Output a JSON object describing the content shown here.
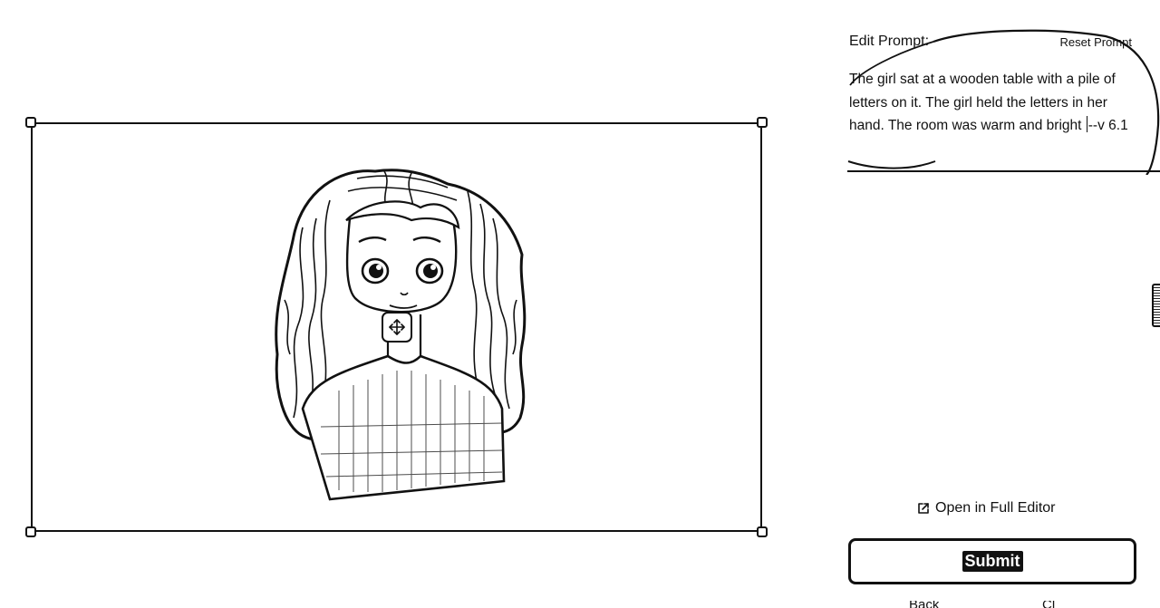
{
  "editor": {
    "title": "Edit Prompt:",
    "reset_label": "Reset Prompt",
    "prompt_before_cursor": "The girl sat at a wooden table with a pile of letters on it. The girl held the letters in her hand. The room was warm and bright ",
    "prompt_after_cursor": "--v 6.1",
    "open_full_editor_label": "Open in Full Editor",
    "submit_label": "Submit"
  },
  "footer": {
    "left_label": "Back",
    "right_label": "Cl"
  },
  "icons": {
    "move": "move-arrows-icon",
    "external_link": "external-link-icon"
  },
  "colors": {
    "ink": "#111111",
    "background": "#ffffff"
  }
}
